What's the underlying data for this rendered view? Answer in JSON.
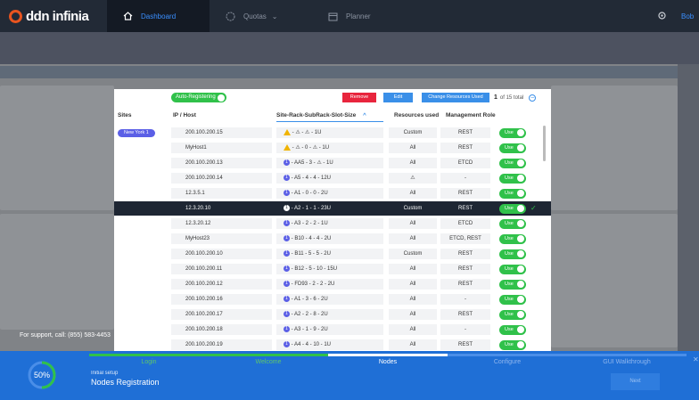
{
  "app": {
    "brand": "ddn infinia"
  },
  "nav": {
    "tabs": [
      {
        "label": "Dashboard",
        "icon": "home-icon",
        "active": true
      },
      {
        "label": "Quotas",
        "icon": "gauge-icon",
        "active": false
      },
      {
        "label": "Planner",
        "icon": "calendar-icon",
        "active": false
      }
    ],
    "user": "Bob"
  },
  "support_text": "For support, call: (855) 583-4453",
  "toolbar": {
    "auto_registering": "Auto-Registering",
    "remove": "Remove",
    "edit": "Edit",
    "change_resources": "Change Resources Used",
    "page": "1",
    "of_total": "of 15 total",
    "more": "–"
  },
  "table": {
    "headers": {
      "sites": "Sites",
      "ip": "IP / Host",
      "location": "Site-Rack-SubRack-Slot-Size",
      "resources": "Resources used",
      "role": "Management Role"
    },
    "site_pill": "New York 1",
    "use_label": "Use",
    "rows": [
      {
        "ip": "200.100.200.15",
        "loc": " -  ⚠  -  ⚠  -  1U",
        "res": "Custom",
        "role": "REST",
        "first": "warn",
        "loc_warn": true
      },
      {
        "ip": "MyHost1",
        "loc": " -  ⚠  -  0  -  ⚠  -  1U",
        "res": "All",
        "role": "REST",
        "first": "warn"
      },
      {
        "ip": "200.100.200.13",
        "loc": " -  AA5  -  3  -  ⚠  -  1U",
        "res": "All",
        "role": "ETCD",
        "first": "badge"
      },
      {
        "ip": "200.100.200.14",
        "loc": " -  A5  -  4  -  4  -  12U",
        "res": "⚠",
        "role": "-",
        "first": "badge"
      },
      {
        "ip": "12.3.5.1",
        "loc": " -  A1  -  0  -  0  -  2U",
        "res": "All",
        "role": "REST",
        "first": "badge"
      },
      {
        "ip": "12.3.20.10",
        "loc": " -  A2  -  1  -  1  -  23U",
        "res": "Custom",
        "role": "REST",
        "first": "badge",
        "selected": true
      },
      {
        "ip": "12.3.20.12",
        "loc": " -  A3  -  2  -  2  -  1U",
        "res": "All",
        "role": "ETCD",
        "first": "badge"
      },
      {
        "ip": "MyHost23",
        "loc": " -  B10  -  4  -  4  -  2U",
        "res": "All",
        "role": "ETCD, REST",
        "first": "badge"
      },
      {
        "ip": "200.100.200.10",
        "loc": " -  B11  -  5  -  5  -  2U",
        "res": "Custom",
        "role": "REST",
        "first": "badge"
      },
      {
        "ip": "200.100.200.11",
        "loc": " -  B12  -  5  -  10  -  15U",
        "res": "All",
        "role": "REST",
        "first": "badge"
      },
      {
        "ip": "200.100.200.12",
        "loc": " -  FD93  -  2  -  2  -  2U",
        "res": "All",
        "role": "REST",
        "first": "badge"
      },
      {
        "ip": "200.100.200.16",
        "loc": " -  A1  -  3  -  6  -  2U",
        "res": "All",
        "role": "-",
        "first": "badge"
      },
      {
        "ip": "200.100.200.17",
        "loc": " -  A2  -  2  -  8  -  2U",
        "res": "All",
        "role": "REST",
        "first": "badge"
      },
      {
        "ip": "200.100.200.18",
        "loc": " -  A3  -  1  -  9  -  2U",
        "res": "All",
        "role": "-",
        "first": "badge"
      },
      {
        "ip": "200.100.200.19",
        "loc": " -  A4  -  4  -  10  -  1U",
        "res": "All",
        "role": "REST",
        "first": "badge"
      }
    ]
  },
  "setup": {
    "steps": [
      "Login",
      "Welcome",
      "Nodes",
      "Configure",
      "GUI Walkthrough"
    ],
    "done_steps": 2,
    "active_step": 2,
    "progress_label": "50%",
    "progress_fraction": 0.5,
    "subtitle": "Initial setup",
    "title": "Nodes Registration",
    "next": "Next"
  },
  "colors": {
    "topbar": "#222a36",
    "accent": "#3a8fff",
    "remove": "#e8253d",
    "toggle_on": "#30c14a",
    "site_pill": "#5b5fe6",
    "footer": "#1f6fd6"
  }
}
